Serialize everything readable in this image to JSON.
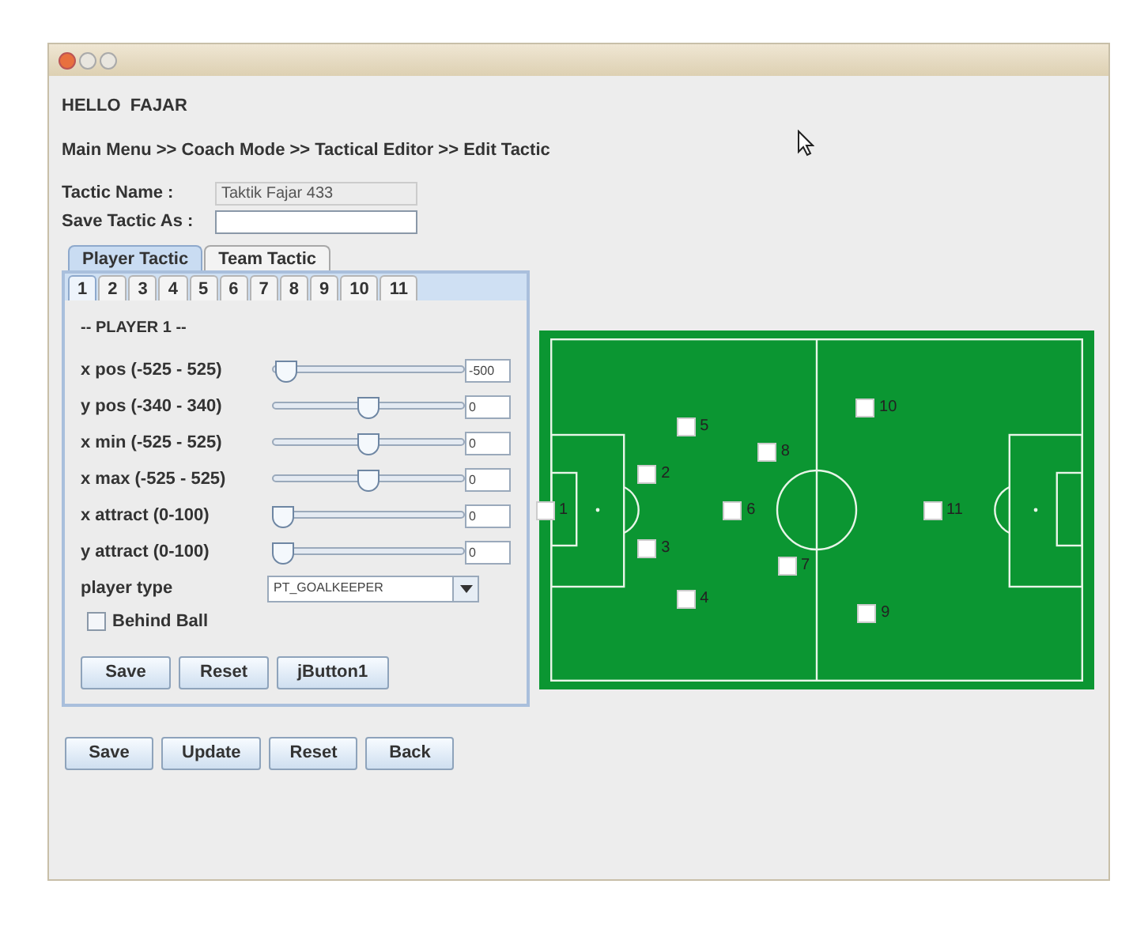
{
  "greeting": "HELLO  FAJAR",
  "breadcrumb": "Main Menu >> Coach Mode >> Tactical Editor >> Edit Tactic",
  "fields": [
    {
      "label": "Tactic Name :",
      "value": "Taktik Fajar 433",
      "disabled": true
    },
    {
      "label": "Save Tactic As :",
      "disabled": false
    }
  ],
  "tabs": [
    {
      "label": "Player Tactic",
      "selected": true
    },
    {
      "label": "Team Tactic",
      "selected": false
    }
  ],
  "player_tabs": [
    {
      "label": "1",
      "selected": true
    },
    {
      "label": "2",
      "selected": false
    },
    {
      "label": "3",
      "selected": false
    },
    {
      "label": "4",
      "selected": false
    },
    {
      "label": "5",
      "selected": false
    },
    {
      "label": "6",
      "selected": false
    },
    {
      "label": "7",
      "selected": false
    },
    {
      "label": "8",
      "selected": false
    },
    {
      "label": "9",
      "selected": false
    },
    {
      "label": "10",
      "selected": false
    },
    {
      "label": "11",
      "selected": false
    }
  ],
  "player_heading": "-- PLAYER 1 --",
  "sliders": [
    {
      "label": "x pos (-525 - 525)",
      "level": 0.02,
      "value": "-500"
    },
    {
      "label": "y pos (-340 - 340)",
      "level": 0.5,
      "value": "0"
    },
    {
      "label": "x min (-525 - 525)",
      "level": 0.5,
      "value": "0"
    },
    {
      "label": "x max (-525 - 525)",
      "level": 0.5,
      "value": "0"
    },
    {
      "label": "x attract (0-100)",
      "level": 0,
      "value": "0"
    },
    {
      "label": "y attract (0-100)",
      "level": 0,
      "value": "0"
    }
  ],
  "player_type": {
    "label": "player type",
    "value": "PT_GOALKEEPER"
  },
  "behind_ball": {
    "label": "Behind Ball",
    "checked": false
  },
  "player_buttons": [
    "Save",
    "Reset",
    "jButton1"
  ],
  "field_players": [
    "1",
    "2",
    "3",
    "4",
    "5",
    "6",
    "7",
    "8",
    "9",
    "10",
    "11"
  ],
  "buttons": [
    "Save",
    "Update",
    "Reset",
    "Back"
  ]
}
